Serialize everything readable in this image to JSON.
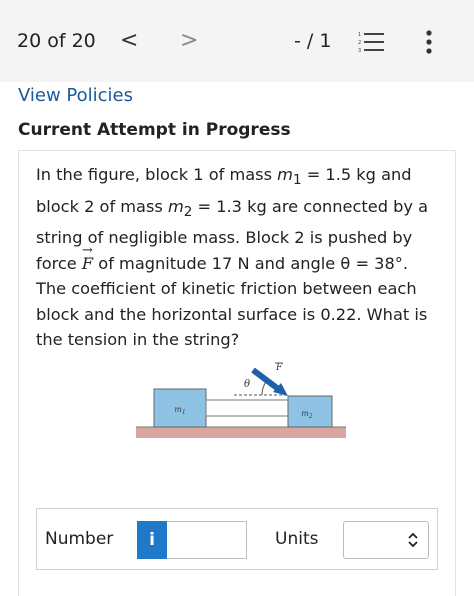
{
  "header": {
    "counter": "20 of 20",
    "prev_glyph": "<",
    "next_glyph": ">",
    "score": "- / 1",
    "list_icon": "list-icon",
    "more_icon": "more-vertical-icon"
  },
  "links": {
    "view_policies": "View Policies"
  },
  "section": {
    "title": "Current Attempt in Progress"
  },
  "question": {
    "p1": "In the figure, block 1 of mass ",
    "m1_var": "m",
    "m1_sub": "1",
    "p2": " = 1.5 kg and block 2 of mass ",
    "m2_var": "m",
    "m2_sub": "2",
    "p3": " = 1.3 kg are connected by a string of negligible mass. Block 2 is pushed by force ",
    "force_var": "F",
    "p4": " of magnitude 17 N and angle θ = 38°. The coefficient of kinetic friction between each block and the horizontal surface is 0.22. What is the tension in the string?"
  },
  "figure": {
    "block1_var": "m",
    "block1_sub": "1",
    "block2_var": "m",
    "block2_sub": "2",
    "angle_label": "θ",
    "force_label": "F"
  },
  "answer": {
    "number_label": "Number",
    "info_label": "i",
    "units_label": "Units",
    "number_value": "",
    "units_value": ""
  },
  "colors": {
    "link": "#1a5a9c",
    "info_button": "#1f78c8",
    "block_fill": "#8fc3e6",
    "ground": "#d9a79f"
  }
}
